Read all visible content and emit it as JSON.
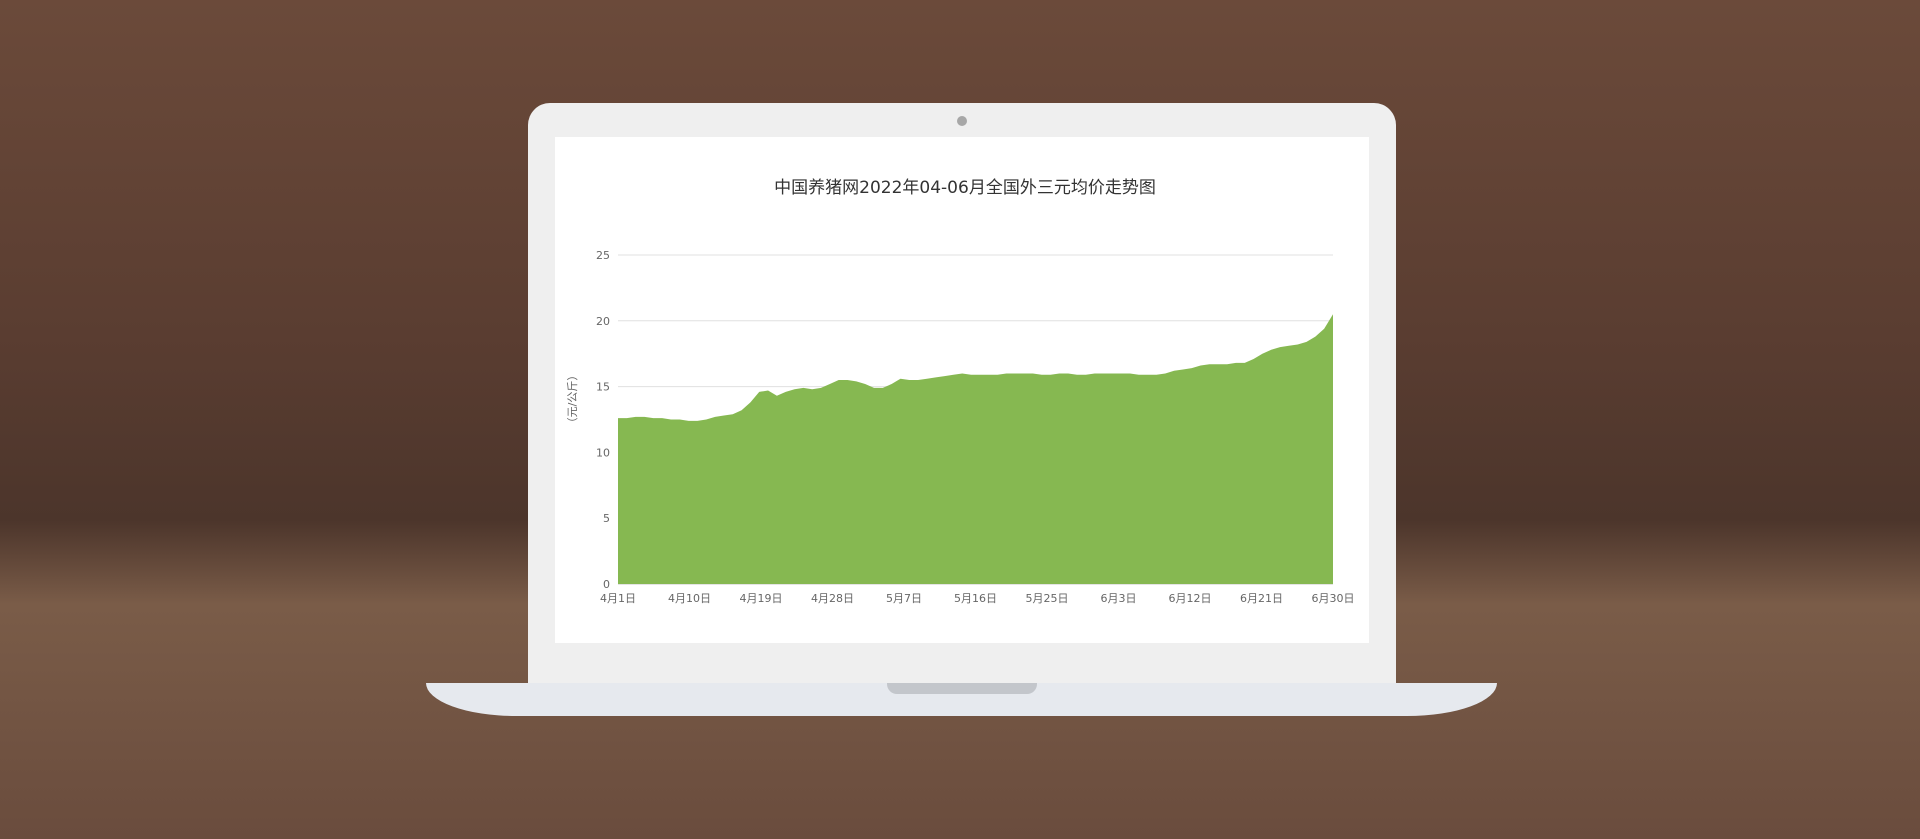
{
  "chart_data": {
    "type": "area",
    "title": "中国养猪网2022年04-06月全国外三元均价走势图",
    "ylabel": "（元/公斤）",
    "xlabel": "",
    "ylim": [
      0,
      25
    ],
    "yticks": [
      0,
      5,
      10,
      15,
      20,
      25
    ],
    "xtick_labels": [
      "4月1日",
      "4月10日",
      "4月19日",
      "4月28日",
      "5月7日",
      "5月16日",
      "5月25日",
      "6月3日",
      "6月12日",
      "6月21日",
      "6月30日"
    ],
    "grid": true,
    "legend": "none",
    "fill_color": "#86b851",
    "series": [
      {
        "values": [
          12.6,
          12.6,
          12.7,
          12.7,
          12.6,
          12.6,
          12.5,
          12.5,
          12.4,
          12.4,
          12.5,
          12.7,
          12.8,
          12.9,
          13.2,
          13.8,
          14.6,
          14.7,
          14.3,
          14.6,
          14.8,
          14.9,
          14.8,
          14.9,
          15.2,
          15.5,
          15.5,
          15.4,
          15.2,
          14.9,
          14.9,
          15.2,
          15.6,
          15.5,
          15.5,
          15.6,
          15.7,
          15.8,
          15.9,
          16.0,
          15.9,
          15.9,
          15.9,
          15.9,
          16.0,
          16.0,
          16.0,
          16.0,
          15.9,
          15.9,
          16.0,
          16.0,
          15.9,
          15.9,
          16.0,
          16.0,
          16.0,
          16.0,
          16.0,
          15.9,
          15.9,
          15.9,
          16.0,
          16.2,
          16.3,
          16.4,
          16.6,
          16.7,
          16.7,
          16.7,
          16.8,
          16.8,
          17.1,
          17.5,
          17.8,
          18.0,
          18.1,
          18.2,
          18.4,
          18.8,
          19.4,
          20.5
        ]
      }
    ]
  }
}
